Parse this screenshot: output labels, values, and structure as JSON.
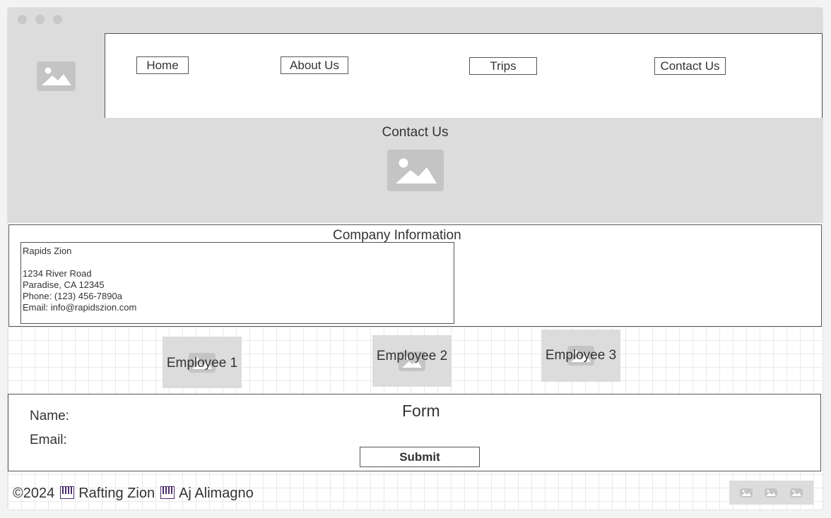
{
  "nav": {
    "items": [
      {
        "label": "Home"
      },
      {
        "label": "About Us"
      },
      {
        "label": "Trips"
      },
      {
        "label": "Contact Us"
      }
    ]
  },
  "hero": {
    "title": "Contact Us"
  },
  "company": {
    "title": "Company Information",
    "lines": [
      "Rapids Zion",
      "",
      "1234 River Road",
      "Paradise, CA 12345",
      "Phone: (123) 456-7890a",
      "Email: info@rapidszion.com"
    ]
  },
  "employees": [
    {
      "label": "Employee 1"
    },
    {
      "label": "Employee 2"
    },
    {
      "label": "Employee 3"
    }
  ],
  "form": {
    "title": "Form",
    "name_label": "Name:",
    "email_label": "Email:",
    "submit_label": "Submit"
  },
  "footer": {
    "copyright": "©2024",
    "brand": "Rafting Zion",
    "author": "Aj Alimagno"
  },
  "icons": {
    "placeholder": "image-icon",
    "separator": "piano-keys-icon"
  },
  "colors": {
    "placeholder_bg": "#dcdcdc",
    "icon_gray": "#c4c4c4",
    "separator_purple": "#4b2d6b",
    "border": "#555555"
  }
}
